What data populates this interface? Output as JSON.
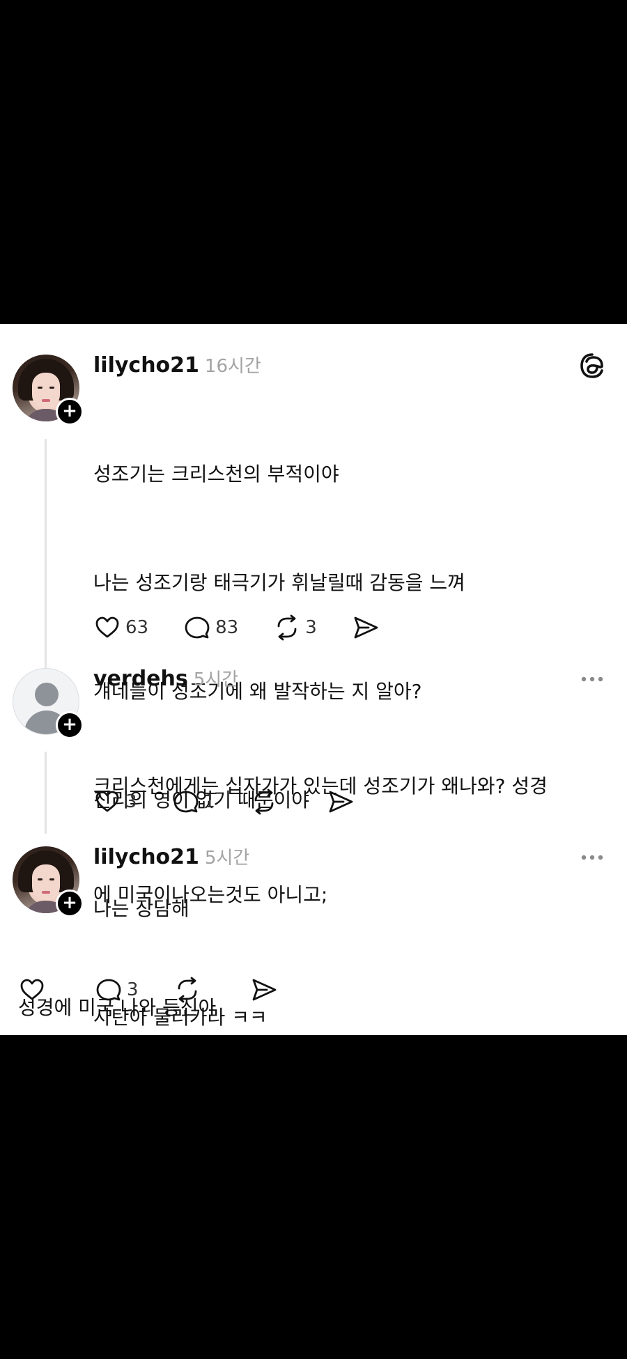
{
  "posts": [
    {
      "username": "lilycho21",
      "time": "16시간",
      "lines": [
        "성조기는 크리스천의 부적이야",
        "나는 성조기랑 태극기가 휘날릴때 감동을 느껴",
        "걔네들이 성조기에 왜 발작하는 지 알아?",
        "진리의 영이 없기 때문이야",
        "나는 장담해",
        "사탄아 물러가라 ㅋㅋ"
      ],
      "counts": {
        "likes": "63",
        "comments": "83",
        "reposts": "3",
        "shares": ""
      },
      "corner_icon": "threads-logo-icon"
    },
    {
      "username": "verdehs",
      "time": "5시간",
      "lines": [
        "크리스천에게는 십자가가 있는데 성조기가 왜나와? 성경",
        "에 미국이나오는것도 아니고;"
      ],
      "counts": {
        "likes": "3",
        "comments": "1",
        "reposts": "",
        "shares": ""
      },
      "corner_icon": "more-options-icon"
    },
    {
      "username": "lilycho21",
      "time": "5시간",
      "lines": [
        "성경에 미국 나와 등신아"
      ],
      "counts": {
        "likes": "",
        "comments": "3",
        "reposts": "",
        "shares": ""
      },
      "corner_icon": "more-options-icon"
    }
  ],
  "colors": {
    "background": "#000000",
    "card": "#ffffff",
    "text": "#111111",
    "muted": "#a3a3a3",
    "thread_line": "#e3e3e3"
  }
}
